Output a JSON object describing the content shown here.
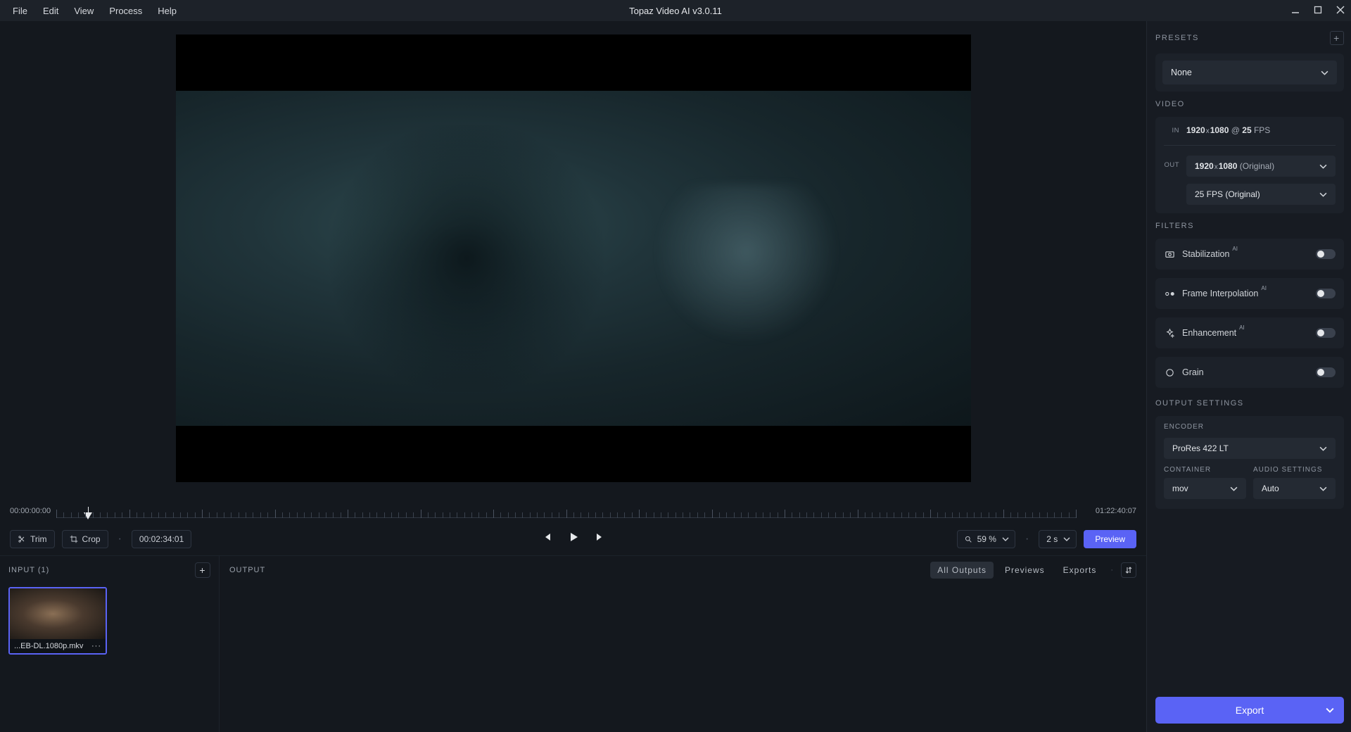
{
  "titlebar": {
    "menu": [
      "File",
      "Edit",
      "View",
      "Process",
      "Help"
    ],
    "title": "Topaz Video AI  v3.0.11"
  },
  "timeline": {
    "start": "00:00:00:00",
    "end": "01:22:40:07"
  },
  "controls": {
    "trim": "Trim",
    "crop": "Crop",
    "current_tc": "00:02:34:01",
    "zoom": "59 %",
    "preview_len": "2 s",
    "preview_btn": "Preview"
  },
  "input_panel": {
    "header": "INPUT (1)",
    "thumb_name": "...EB-DL.1080p.mkv"
  },
  "output_panel": {
    "header": "OUTPUT",
    "tabs": {
      "all": "All Outputs",
      "previews": "Previews",
      "exports": "Exports"
    }
  },
  "sidebar": {
    "presets": {
      "label": "PRESETS",
      "value": "None"
    },
    "video": {
      "label": "VIDEO",
      "in_tag": "IN",
      "in_w": "1920",
      "in_h": "1080",
      "in_at": " @ ",
      "in_fps": "25",
      "in_fps_suffix": " FPS",
      "out_tag": "OUT",
      "out_res": "1920",
      "out_res_h": "1080",
      "out_res_suffix": " (Original)",
      "out_fps": "25 FPS (Original)"
    },
    "filters": {
      "label": "FILTERS",
      "stabilization": "Stabilization",
      "frame_interp": "Frame Interpolation",
      "enhancement": "Enhancement",
      "grain": "Grain",
      "ai": "AI"
    },
    "output_settings": {
      "label": "OUTPUT SETTINGS",
      "encoder_label": "ENCODER",
      "encoder": "ProRes 422 LT",
      "container_label": "CONTAINER",
      "container": "mov",
      "audio_label": "AUDIO SETTINGS",
      "audio": "Auto"
    },
    "export": "Export"
  }
}
